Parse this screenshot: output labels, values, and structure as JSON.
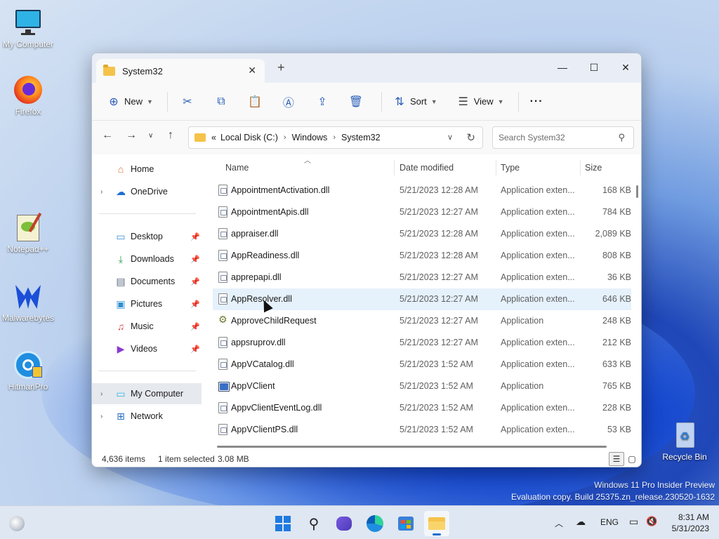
{
  "desktop": {
    "icons": [
      {
        "label": "My Computer"
      },
      {
        "label": "Firefox"
      },
      {
        "label": "Notepad++"
      },
      {
        "label": "Malwarebytes"
      },
      {
        "label": "HitmanPro"
      },
      {
        "label": "Recycle Bin"
      }
    ],
    "watermark": {
      "line1": "Windows 11 Pro Insider Preview",
      "line2": "Evaluation copy. Build 25375.zn_release.230520-1632"
    }
  },
  "window": {
    "tab_title": "System32",
    "tab_close": "✕",
    "new_tab": "+",
    "controls": {
      "minimize": "—",
      "maximize": "☐",
      "close": "✕"
    },
    "toolbar": {
      "new_label": "New",
      "sort_label": "Sort",
      "view_label": "View",
      "more_label": "···"
    },
    "address": {
      "overflow": "«",
      "crumbs": [
        "Local Disk (C:)",
        "Windows",
        "System32"
      ]
    },
    "search": {
      "placeholder": "Search System32"
    },
    "sidebar": {
      "home": "Home",
      "onedrive": "OneDrive",
      "desktop": "Desktop",
      "downloads": "Downloads",
      "documents": "Documents",
      "pictures": "Pictures",
      "music": "Music",
      "videos": "Videos",
      "my_computer": "My Computer",
      "network": "Network"
    },
    "columns": {
      "name": "Name",
      "date": "Date modified",
      "type": "Type",
      "size": "Size"
    },
    "files": [
      {
        "name": "AppointmentActivation.dll",
        "date": "5/21/2023 12:28 AM",
        "type": "Application exten...",
        "size": "168 KB"
      },
      {
        "name": "AppointmentApis.dll",
        "date": "5/21/2023 12:27 AM",
        "type": "Application exten...",
        "size": "784 KB"
      },
      {
        "name": "appraiser.dll",
        "date": "5/21/2023 12:28 AM",
        "type": "Application exten...",
        "size": "2,089 KB"
      },
      {
        "name": "AppReadiness.dll",
        "date": "5/21/2023 12:28 AM",
        "type": "Application exten...",
        "size": "808 KB"
      },
      {
        "name": "apprepapi.dll",
        "date": "5/21/2023 12:27 AM",
        "type": "Application exten...",
        "size": "36 KB"
      },
      {
        "name": "AppResolver.dll",
        "date": "5/21/2023 12:27 AM",
        "type": "Application exten...",
        "size": "646 KB"
      },
      {
        "name": "ApproveChildRequest",
        "date": "5/21/2023 12:27 AM",
        "type": "Application",
        "size": "248 KB"
      },
      {
        "name": "appsruprov.dll",
        "date": "5/21/2023 12:27 AM",
        "type": "Application exten...",
        "size": "212 KB"
      },
      {
        "name": "AppVCatalog.dll",
        "date": "5/21/2023 1:52 AM",
        "type": "Application exten...",
        "size": "633 KB"
      },
      {
        "name": "AppVClient",
        "date": "5/21/2023 1:52 AM",
        "type": "Application",
        "size": "765 KB"
      },
      {
        "name": "AppvClientEventLog.dll",
        "date": "5/21/2023 1:52 AM",
        "type": "Application exten...",
        "size": "228 KB"
      },
      {
        "name": "AppVClientPS.dll",
        "date": "5/21/2023 1:52 AM",
        "type": "Application exten...",
        "size": "53 KB"
      }
    ],
    "status": {
      "items": "4,636 items",
      "selected": "1 item selected",
      "sel_size": "3.08 MB"
    }
  },
  "taskbar": {
    "language": "ENG",
    "time": "8:31 AM",
    "date": "5/31/2023"
  },
  "colors": {
    "accent": "#1f6fd0",
    "folder": "#f5c34a",
    "hover_row": "#e5f1fb"
  }
}
